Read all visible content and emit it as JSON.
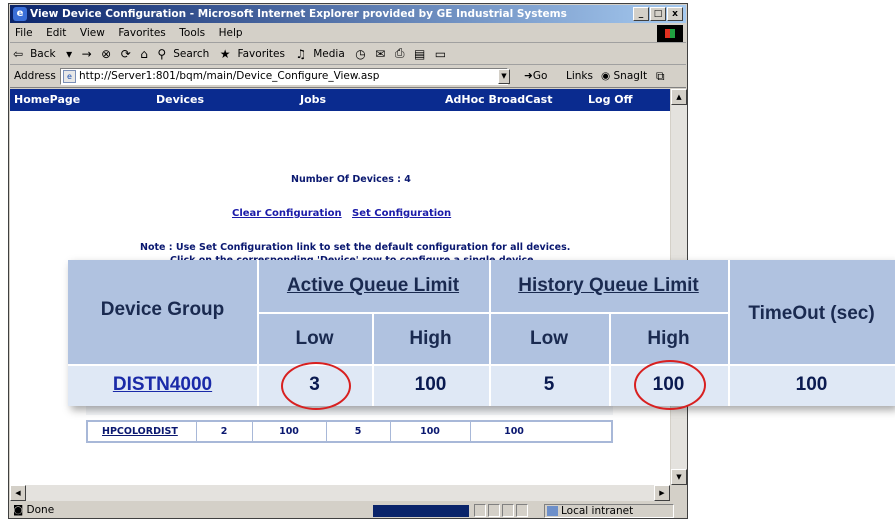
{
  "window": {
    "title": "View Device Configuration - Microsoft Internet Explorer provided by GE Industrial Systems",
    "controls": [
      "_",
      "□",
      "x"
    ]
  },
  "menu": [
    "File",
    "Edit",
    "View",
    "Favorites",
    "Tools",
    "Help"
  ],
  "toolbar": {
    "back": "Back",
    "search": "Search",
    "favorites": "Favorites",
    "media": "Media"
  },
  "address": {
    "label": "Address",
    "url": "http://Server1:801/bqm/main/Device_Configure_View.asp",
    "go": "Go",
    "links": "Links",
    "snagit": "SnagIt"
  },
  "nav": [
    "HomePage",
    "Devices",
    "Jobs",
    "AdHoc BroadCast",
    "Log Off"
  ],
  "page": {
    "device_count": "Number Of Devices : 4",
    "clear_config": "Clear Configuration",
    "set_config": "Set Configuration",
    "note_line1": "Note : Use Set Configuration link to set the default configuration for all devices.",
    "note_line2": "Click on the corresponding 'Device' row to configure a single device."
  },
  "small_table_row": {
    "group": "HPCOLORDIST",
    "active_low": "2",
    "active_high": "100",
    "history_low": "5",
    "history_high": "100",
    "timeout": "100"
  },
  "zoom_table": {
    "headers": {
      "device_group": "Device Group",
      "active_queue_limit": "Active Queue Limit",
      "history_queue_limit": "History Queue Limit",
      "timeout": "TimeOut (sec)",
      "low": "Low",
      "high": "High"
    },
    "row": {
      "group": "DISTN4000",
      "active_low": "3",
      "active_high": "100",
      "history_low": "5",
      "history_high": "100",
      "timeout": "100"
    }
  },
  "status": {
    "text": "Done",
    "zone": "Local intranet"
  },
  "colors": {
    "nav_bg": "#0a2b8f",
    "header_bg": "#b0c2e0",
    "row_bg": "#dfe8f5",
    "highlight_circle": "#d82020"
  }
}
